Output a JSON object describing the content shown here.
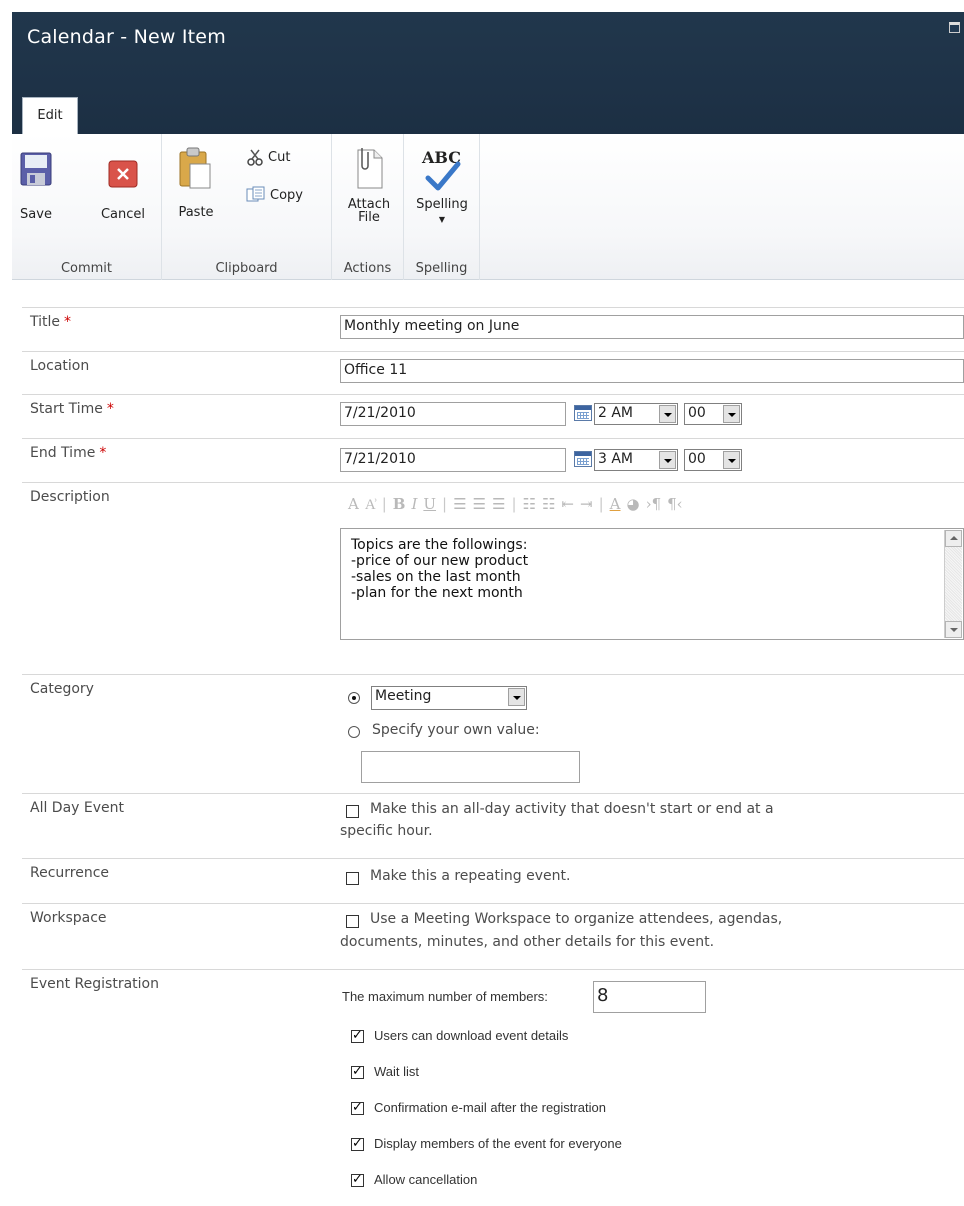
{
  "window": {
    "title": "Calendar - New Item"
  },
  "ribbon": {
    "tab_edit": "Edit",
    "groups": {
      "commit": "Commit",
      "clipboard": "Clipboard",
      "actions": "Actions",
      "spelling": "Spelling"
    },
    "buttons": {
      "save": "Save",
      "cancel": "Cancel",
      "paste": "Paste",
      "cut": "Cut",
      "copy": "Copy",
      "attach_line1": "Attach",
      "attach_line2": "File",
      "spelling": "Spelling",
      "spelling_icon_text": "ABC"
    },
    "icons": [
      "save-icon",
      "cancel-icon",
      "paste-icon",
      "cut-icon",
      "copy-icon",
      "attach-file-icon",
      "spelling-icon"
    ]
  },
  "form": {
    "title": {
      "label": "Title",
      "required": "*",
      "value": "Monthly meeting on June"
    },
    "location": {
      "label": "Location",
      "value": "Office 11"
    },
    "start_time": {
      "label": "Start Time",
      "required": "*",
      "date": "7/21/2010",
      "hour": "2 AM",
      "minute": "00"
    },
    "end_time": {
      "label": "End Time",
      "required": "*",
      "date": "7/21/2010",
      "hour": "3 AM",
      "minute": "00"
    },
    "description": {
      "label": "Description",
      "lines": [
        "Topics are the followings:",
        "-price of our new product",
        "-sales on the last month",
        "-plan for the next month"
      ]
    },
    "category": {
      "label": "Category",
      "selected": "Meeting",
      "own_value_label": "Specify your own value:",
      "own_value": ""
    },
    "all_day": {
      "label": "All Day Event",
      "text_line1": "Make this an all-day activity that doesn't start or end at a",
      "text_line2": "specific hour."
    },
    "recurrence": {
      "label": "Recurrence",
      "text": "Make this a repeating event."
    },
    "workspace": {
      "label": "Workspace",
      "text_line1": "Use a Meeting Workspace to organize attendees, agendas,",
      "text_line2": "documents, minutes, and other details for this event."
    },
    "event_registration": {
      "label": "Event Registration",
      "max_members_label": "The maximum number of members:",
      "max_members": "8",
      "options": [
        {
          "text": "Users can download event details",
          "checked": true
        },
        {
          "text": "Wait list",
          "checked": true
        },
        {
          "text": "Confirmation e-mail after the registration",
          "checked": true
        },
        {
          "text": "Display members of the event for everyone",
          "checked": true
        },
        {
          "text": "Allow cancellation",
          "checked": true
        }
      ]
    }
  }
}
